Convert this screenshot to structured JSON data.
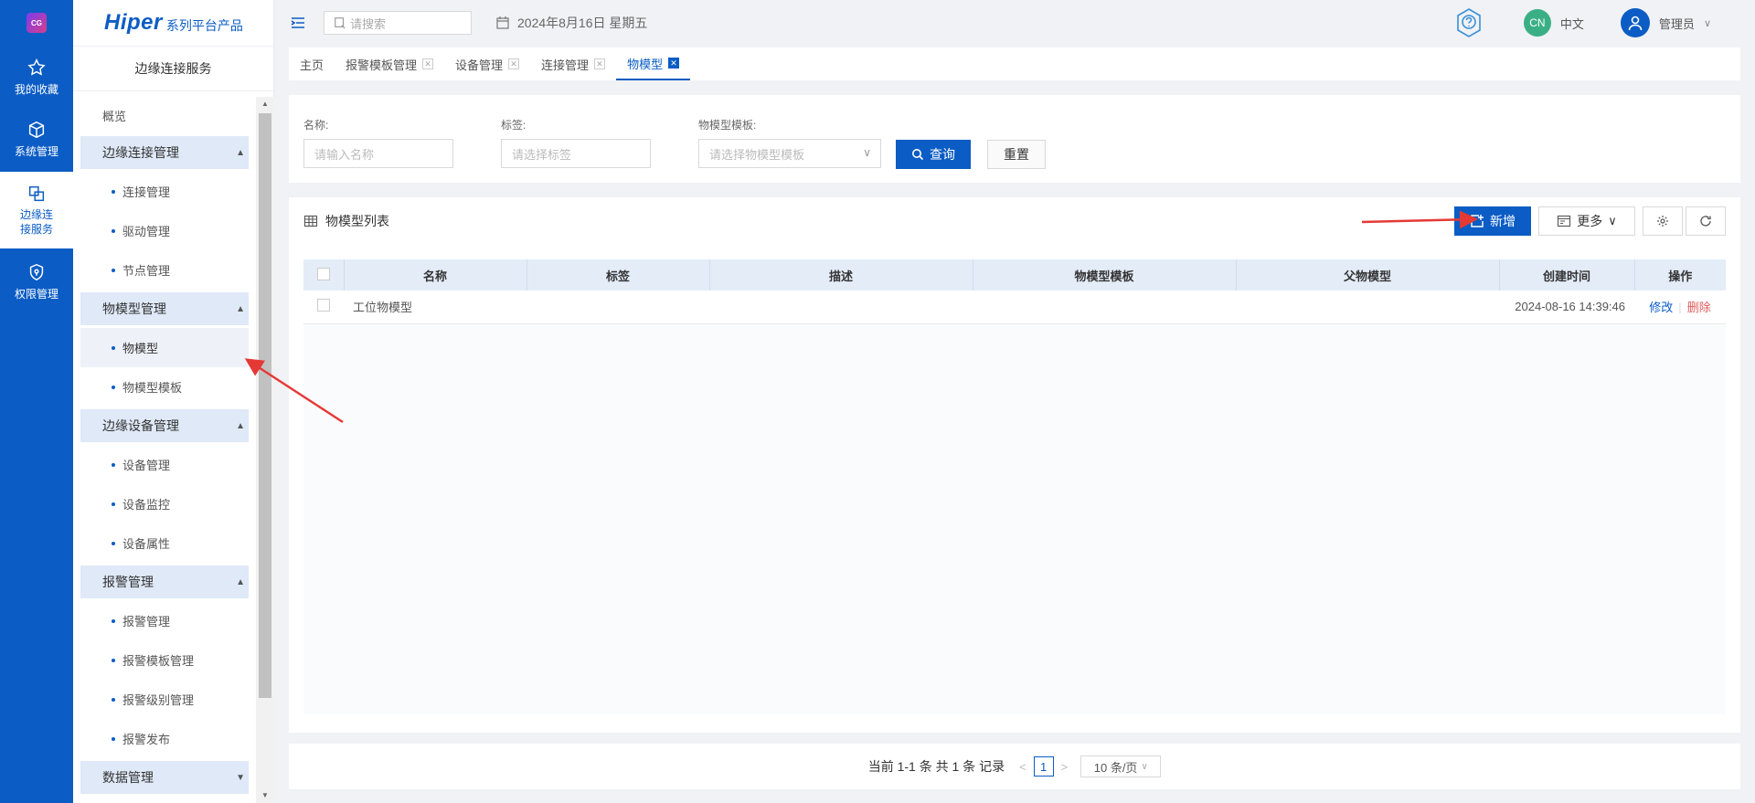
{
  "rail": {
    "items": [
      {
        "label": "我的收藏",
        "icon": "star-icon"
      },
      {
        "label": "系统管理",
        "icon": "cube-icon"
      },
      {
        "label": "边缘连接服务",
        "icon": "link-icon"
      },
      {
        "label": "权限管理",
        "icon": "shield-icon"
      }
    ],
    "active_index": 2
  },
  "brand": {
    "name": "Hiper",
    "suffix": "系列平台产品"
  },
  "sidebar": {
    "title": "边缘连接服务",
    "overview": "概览",
    "groups": [
      {
        "label": "边缘连接管理",
        "items": [
          "连接管理",
          "驱动管理",
          "节点管理"
        ]
      },
      {
        "label": "物模型管理",
        "items": [
          "物模型",
          "物模型模板"
        ]
      },
      {
        "label": "边缘设备管理",
        "items": [
          "设备管理",
          "设备监控",
          "设备属性"
        ]
      },
      {
        "label": "报警管理",
        "items": [
          "报警管理",
          "报警模板管理",
          "报警级别管理",
          "报警发布"
        ]
      },
      {
        "label": "数据管理",
        "items": []
      }
    ],
    "active_item": "物模型"
  },
  "topbar": {
    "search_placeholder": "请搜索",
    "date": "2024年8月16日 星期五",
    "lang_badge": "CN",
    "lang_label": "中文",
    "user": "管理员"
  },
  "tabs": [
    {
      "label": "主页",
      "closable": false,
      "active": false
    },
    {
      "label": "报警模板管理",
      "closable": true,
      "active": false
    },
    {
      "label": "设备管理",
      "closable": true,
      "active": false
    },
    {
      "label": "连接管理",
      "closable": true,
      "active": false
    },
    {
      "label": "物模型",
      "closable": true,
      "active": true
    }
  ],
  "filter": {
    "name_label": "名称:",
    "name_placeholder": "请输入名称",
    "tag_label": "标签:",
    "tag_placeholder": "请选择标签",
    "template_label": "物模型模板:",
    "template_placeholder": "请选择物模型模板",
    "query_label": "查询",
    "reset_label": "重置"
  },
  "list": {
    "title": "物模型列表",
    "add_label": "新增",
    "more_label": "更多",
    "columns": [
      "名称",
      "标签",
      "描述",
      "物模型模板",
      "父物模型",
      "创建时间",
      "操作"
    ],
    "rows": [
      {
        "name": "工位物模型",
        "tag": "",
        "desc": "",
        "template": "",
        "parent": "",
        "created": "2024-08-16 14:39:46",
        "edit": "修改",
        "delete": "删除"
      }
    ]
  },
  "pagination": {
    "summary": "当前 1-1 条 共 1 条 记录",
    "page": "1",
    "page_size": "10 条/页"
  },
  "colors": {
    "primary": "#0b5cc5",
    "danger": "#e45b5b",
    "arrow": "#e53935",
    "header_bg": "#e4ecf8"
  }
}
